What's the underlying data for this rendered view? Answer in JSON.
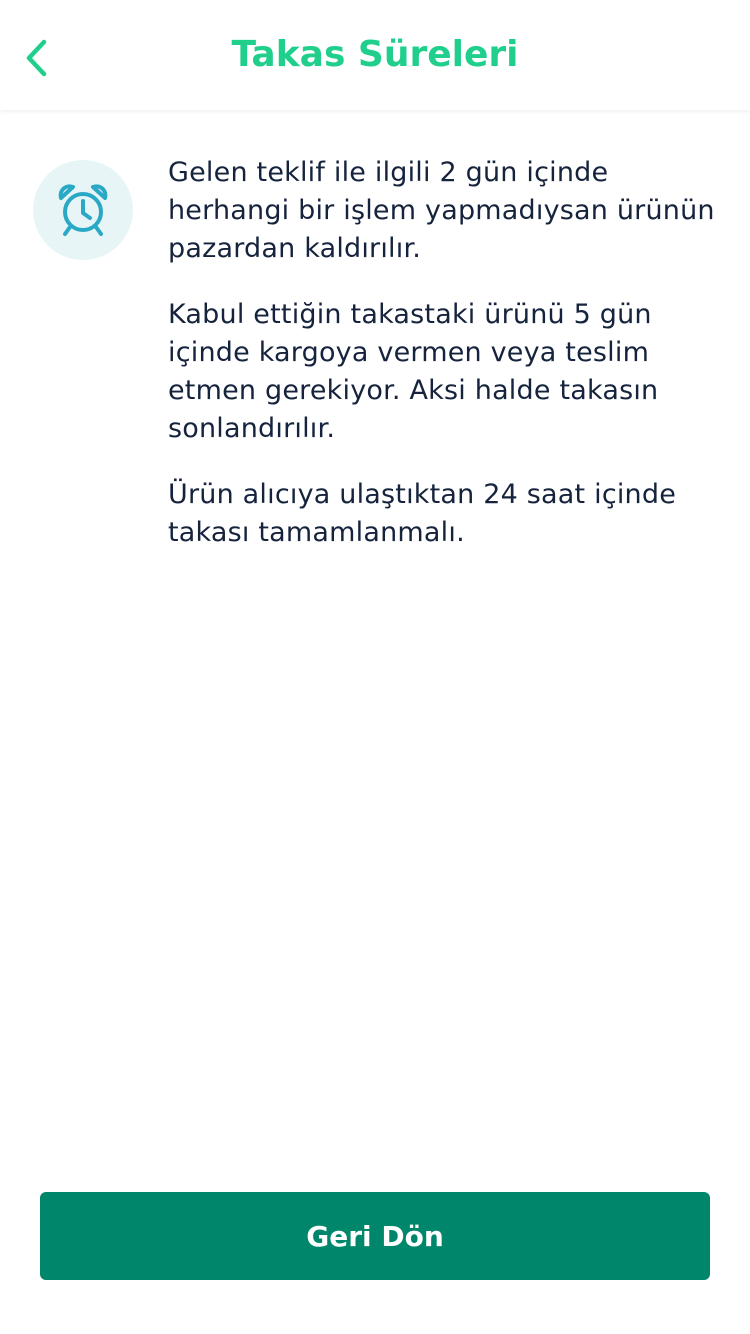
{
  "colors": {
    "accent": "#1fcf8b",
    "button_bg": "#00866b",
    "text": "#16233d",
    "icon_stroke": "#2aa9c6",
    "icon_bg": "#e8f5f7"
  },
  "header": {
    "back_icon": "chevron-left-icon",
    "title": "Takas Süreleri"
  },
  "content": {
    "icon": "alarm-clock-icon",
    "paragraphs": [
      "Gelen teklif ile ilgili 2 gün içinde herhangi bir işlem yapmadıysan ürünün pazardan kaldırılır.",
      "Kabul ettiğin takastaki ürünü 5 gün içinde kargoya vermen veya teslim etmen gerekiyor. Aksi halde takasın sonlandırılır.",
      "Ürün alıcıya ulaştıktan 24 saat içinde takası tamamlanmalı."
    ]
  },
  "footer": {
    "back_button_label": "Geri Dön"
  }
}
